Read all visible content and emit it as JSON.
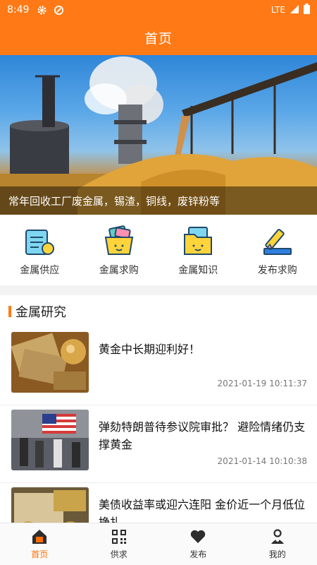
{
  "status": {
    "time": "8:49",
    "network": "LTE"
  },
  "header": {
    "title": "首页"
  },
  "banner": {
    "caption": "常年回收工厂废金属，锡渣，铜线，废锌粉等"
  },
  "categories": [
    {
      "label": "金属供应",
      "icon": "document-invoice-icon"
    },
    {
      "label": "金属求购",
      "icon": "basket-icon"
    },
    {
      "label": "金属知识",
      "icon": "folder-icon"
    },
    {
      "label": "发布求购",
      "icon": "pencil-icon"
    }
  ],
  "section": {
    "title": "金属研究"
  },
  "news": [
    {
      "title": "黄金中长期迎利好！",
      "date": "2021-01-19 10:11:37"
    },
    {
      "title": "弹劾特朗普待参议院审批？ 避险情绪仍支撑黄金",
      "date": "2021-01-14 10:10:38"
    },
    {
      "title": "美债收益率或迎六连阳 金价近一个月低位挣扎",
      "date": ""
    }
  ],
  "tabs": [
    {
      "label": "首页",
      "active": true
    },
    {
      "label": "供求",
      "active": false
    },
    {
      "label": "发布",
      "active": false
    },
    {
      "label": "我的",
      "active": false
    }
  ],
  "colors": {
    "accent": "#ff7a16",
    "active_tab": "#ff6d00"
  }
}
